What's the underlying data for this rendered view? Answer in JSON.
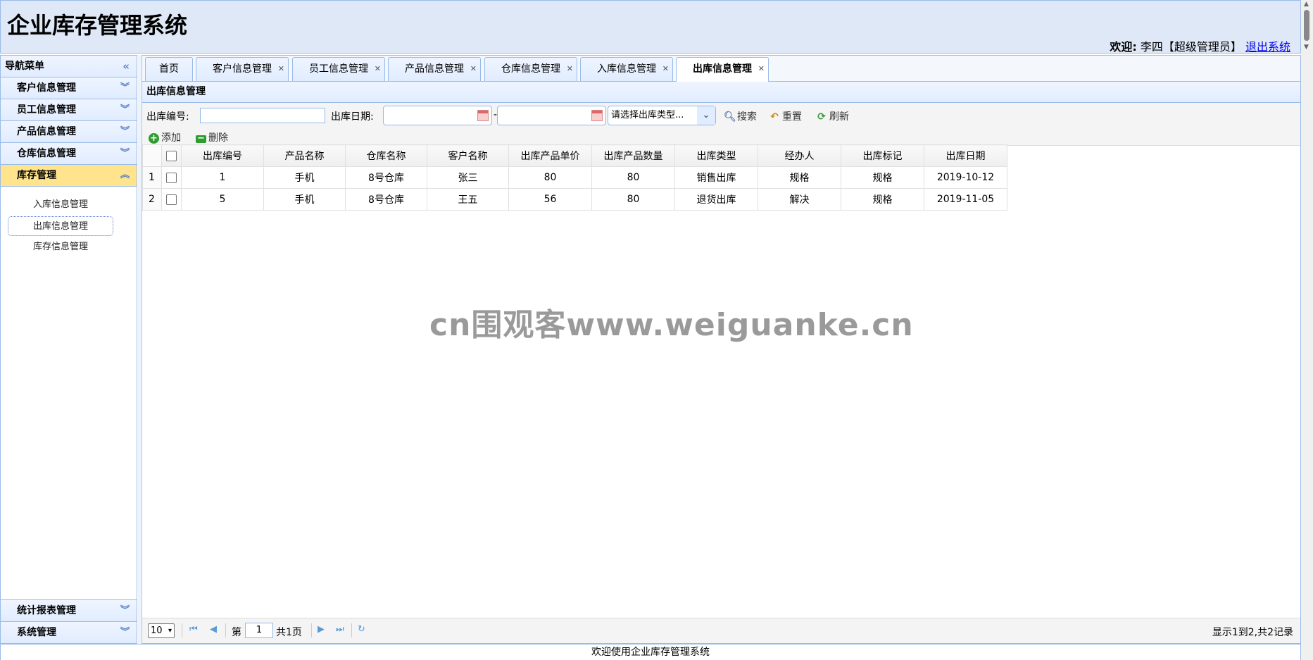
{
  "header": {
    "app_title": "企业库存管理系统",
    "welcome_label": "欢迎:",
    "user_info": "李四【超级管理员】",
    "logout_link": "退出系统"
  },
  "sidebar": {
    "title": "导航菜单",
    "items": [
      {
        "label": "客户信息管理"
      },
      {
        "label": "员工信息管理"
      },
      {
        "label": "产品信息管理"
      },
      {
        "label": "仓库信息管理"
      },
      {
        "label": "库存管理"
      }
    ],
    "sub_items": [
      {
        "label": "入库信息管理"
      },
      {
        "label": "出库信息管理"
      },
      {
        "label": "库存信息管理"
      }
    ],
    "bottom_items": [
      {
        "label": "统计报表管理"
      },
      {
        "label": "系统管理"
      }
    ]
  },
  "tabs": [
    {
      "label": "首页"
    },
    {
      "label": "客户信息管理"
    },
    {
      "label": "员工信息管理"
    },
    {
      "label": "产品信息管理"
    },
    {
      "label": "仓库信息管理"
    },
    {
      "label": "入库信息管理"
    },
    {
      "label": "出库信息管理"
    }
  ],
  "panel_title": "出库信息管理",
  "search": {
    "id_label": "出库编号:",
    "date_label": "出库日期:",
    "date_separator": "-",
    "type_placeholder": "请选择出库类型...",
    "search_btn": "搜索",
    "reset_btn": "重置",
    "refresh_btn": "刷新",
    "add_btn": "添加",
    "delete_btn": "删除"
  },
  "table": {
    "headers": [
      "出库编号",
      "产品名称",
      "仓库名称",
      "客户名称",
      "出库产品单价",
      "出库产品数量",
      "出库类型",
      "经办人",
      "出库标记",
      "出库日期"
    ],
    "rows": [
      {
        "rn": "1",
        "cells": [
          "1",
          "手机",
          "8号仓库",
          "张三",
          "80",
          "80",
          "销售出库",
          "规格",
          "规格",
          "2019-10-12"
        ]
      },
      {
        "rn": "2",
        "cells": [
          "5",
          "手机",
          "8号仓库",
          "王五",
          "56",
          "80",
          "退货出库",
          "解决",
          "规格",
          "2019-11-05"
        ]
      }
    ]
  },
  "pager": {
    "page_size": "10",
    "page_prefix": "第",
    "page_value": "1",
    "page_suffix": "共1页",
    "info": "显示1到2,共2记录"
  },
  "footer": "欢迎使用企业库存管理系统",
  "watermark": "cn围观客www.weiguanke.cn"
}
